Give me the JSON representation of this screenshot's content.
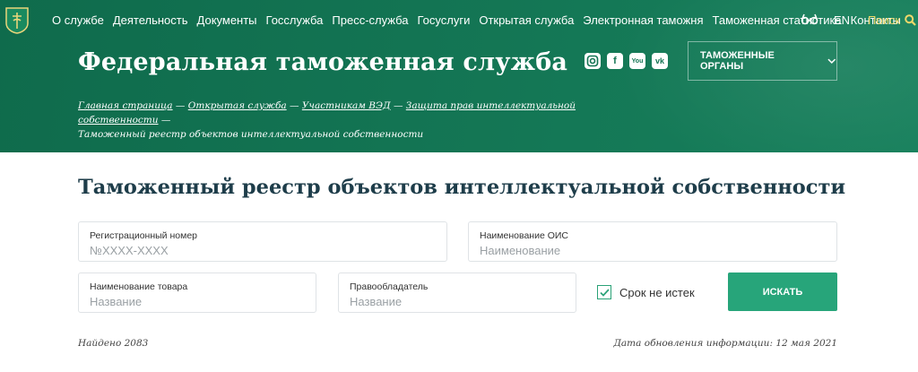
{
  "nav": {
    "items": [
      "О службе",
      "Деятельность",
      "Документы",
      "Госслужба",
      "Пресс-служба",
      "Госуслуги",
      "Открытая служба",
      "Электронная таможня",
      "Таможенная статистика",
      "Контакты"
    ],
    "lang": "EN",
    "search_label": "Поиск"
  },
  "header": {
    "site_title": "Федеральная таможенная служба",
    "organs_label": "ТАМОЖЕННЫЕ ОРГАНЫ",
    "socials": [
      "instagram-icon",
      "facebook-icon",
      "youtube-icon",
      "vk-icon"
    ]
  },
  "breadcrumbs": {
    "items": [
      "Главная страница",
      "Открытая служба",
      "Участникам ВЭД",
      "Защита прав интеллектуальной собственности"
    ],
    "separator": "—",
    "current": "Таможенный реестр объектов интеллектуальной собственности"
  },
  "page": {
    "title": "Таможенный реестр объектов интеллектуальной собственности"
  },
  "form": {
    "reg_number": {
      "label": "Регистрационный номер",
      "placeholder": "№ХХХХ-ХХХХ",
      "value": ""
    },
    "ois_name": {
      "label": "Наименование ОИС",
      "placeholder": "Наименование",
      "value": ""
    },
    "product_name": {
      "label": "Наименование товара",
      "placeholder": "Название",
      "value": ""
    },
    "rightholder": {
      "label": "Правообладатель",
      "placeholder": "Название",
      "value": ""
    },
    "not_expired": {
      "label": "Срок не истек",
      "checked": true
    },
    "search_button": "ИСКАТЬ"
  },
  "results": {
    "found": "Найдено 2083",
    "updated": "Дата обновления информации: 12 мая 2021"
  },
  "colors": {
    "brand_green": "#137453",
    "button_green": "#27a57a",
    "search_yellow": "#f0d86a",
    "title_dark": "#1e3d4a"
  }
}
